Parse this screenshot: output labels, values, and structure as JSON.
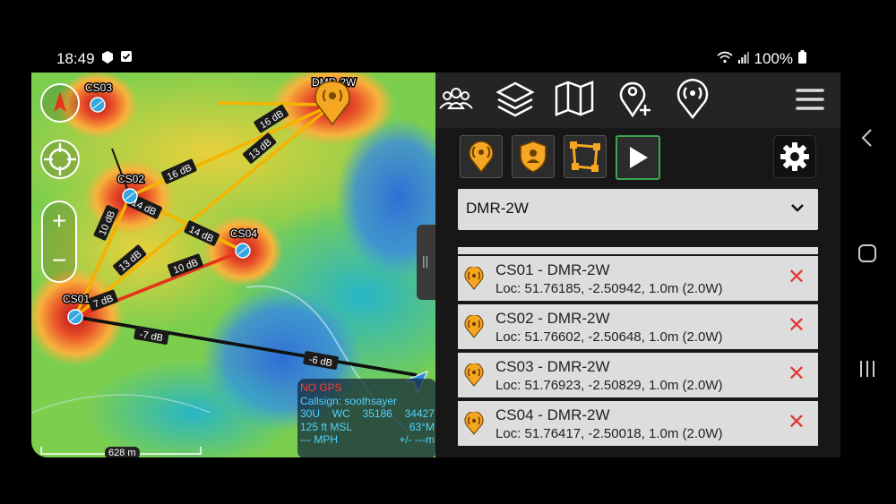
{
  "status_bar": {
    "time": "18:49",
    "battery": "100%",
    "left_icons": [
      "notification-icon",
      "checkbox-icon"
    ],
    "right_icons": [
      "wifi-icon",
      "signal-icon",
      "battery-icon"
    ]
  },
  "map": {
    "sites": [
      {
        "label": "CS01"
      },
      {
        "label": "CS02"
      },
      {
        "label": "CS03"
      },
      {
        "label": "CS04"
      },
      {
        "label": "DMR-2W"
      }
    ],
    "links": [
      {
        "label": "16 dB",
        "color": "#f5b400"
      },
      {
        "label": "13 dB",
        "color": "#f5b400"
      },
      {
        "label": "16 dB",
        "color": "#f5b400"
      },
      {
        "label": "14 dB",
        "color": "#f5b400"
      },
      {
        "label": "14 dB",
        "color": "#f5b400"
      },
      {
        "label": "10 dB",
        "color": "#e8321c"
      },
      {
        "label": "13 dB",
        "color": "#f5b400"
      },
      {
        "label": "10 dB",
        "color": "#e8321c"
      },
      {
        "label": "7 dB",
        "color": "#e8321c"
      },
      {
        "label": "-7 dB",
        "color": "#111111"
      },
      {
        "label": "-6 dB",
        "color": "#111111"
      }
    ],
    "info": {
      "gps": "NO GPS",
      "callsign": "Callsign: soothsayer",
      "grid_zone": "30U",
      "grid_square": "WC",
      "easting": "35186",
      "northing": "34427",
      "altitude": "125 ft MSL",
      "heading": "63°M",
      "speed": "--- MPH",
      "accuracy": "+/- ---m"
    },
    "scale": "628 m"
  },
  "toolbar": {
    "icons": [
      "contacts-icon",
      "layers-icon",
      "map-icon",
      "add-marker-icon",
      "radio-marker-icon",
      "menu-icon"
    ]
  },
  "tools": {
    "icons": [
      "radio-site-icon",
      "shield-user-icon",
      "polygon-icon",
      "play-icon",
      "settings-icon"
    ]
  },
  "dropdown": {
    "value": "DMR-2W"
  },
  "list": [
    {
      "title": "CS01 - DMR-2W",
      "loc": "Loc: 51.76185, -2.50942, 1.0m (2.0W)"
    },
    {
      "title": "CS02 - DMR-2W",
      "loc": "Loc: 51.76602, -2.50648, 1.0m (2.0W)"
    },
    {
      "title": "CS03 - DMR-2W",
      "loc": "Loc: 51.76923, -2.50829, 1.0m (2.0W)"
    },
    {
      "title": "CS04 - DMR-2W",
      "loc": "Loc: 51.76417, -2.50018, 1.0m (2.0W)"
    }
  ],
  "colors": {
    "accent": "#f5a623",
    "strong_link": "#f5b400",
    "weak_link": "#e8321c",
    "negative_link": "#111111",
    "delete": "#e53935",
    "play_border": "#3fa34d"
  }
}
